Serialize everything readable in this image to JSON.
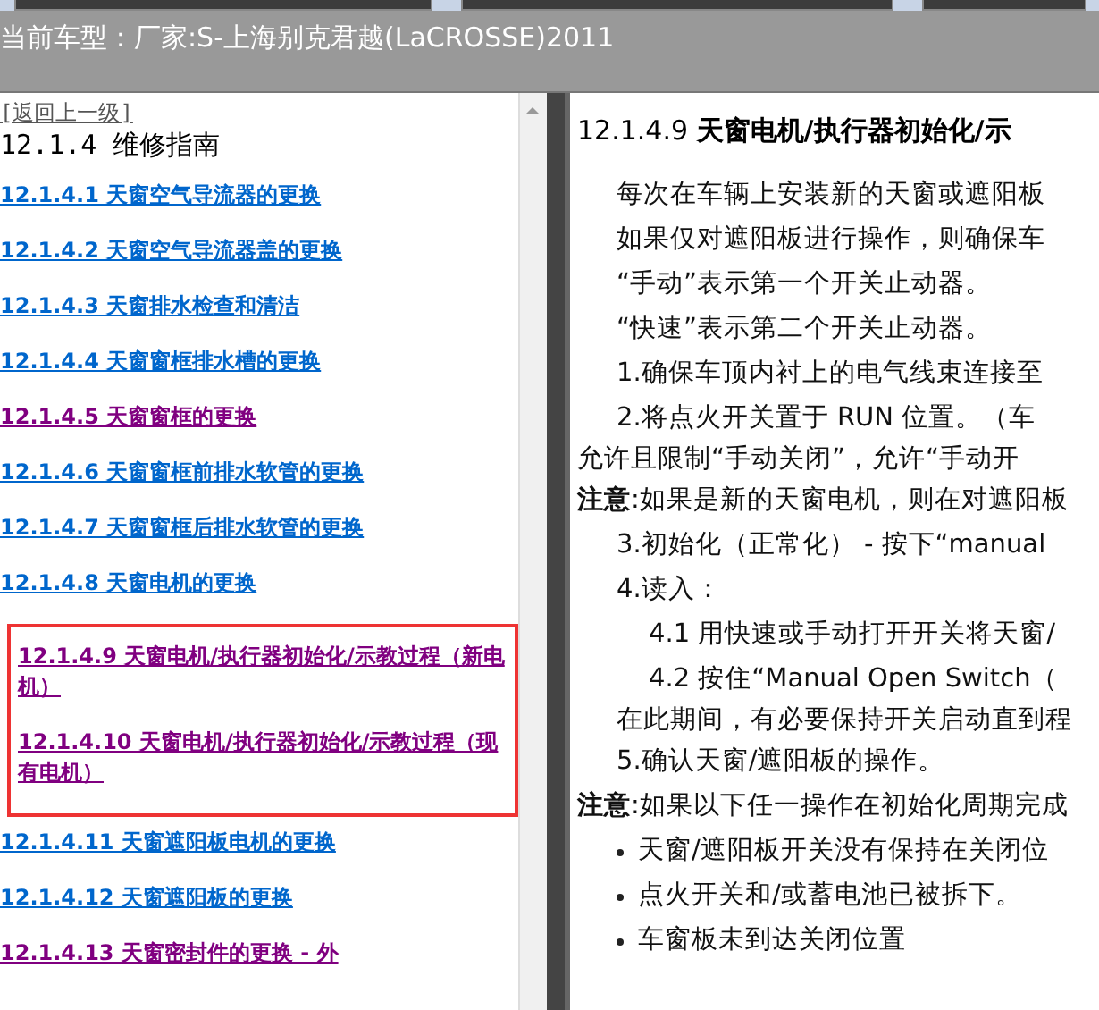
{
  "header": {
    "model_label": "当前车型：厂家:S-上海别克君越(LaCROSSE)2011"
  },
  "left_pane": {
    "back_link": "[返回上一级]",
    "heading": "12.1.4 维修指南",
    "items": [
      {
        "label": "12.1.4.1 天窗空气导流器的更换",
        "visited": false,
        "boxed": false
      },
      {
        "label": "12.1.4.2 天窗空气导流器盖的更换",
        "visited": false,
        "boxed": false
      },
      {
        "label": "12.1.4.3 天窗排水检查和清洁",
        "visited": false,
        "boxed": false
      },
      {
        "label": "12.1.4.4 天窗窗框排水槽的更换",
        "visited": false,
        "boxed": false
      },
      {
        "label": "12.1.4.5 天窗窗框的更换",
        "visited": true,
        "boxed": false
      },
      {
        "label": "12.1.4.6 天窗窗框前排水软管的更换",
        "visited": false,
        "boxed": false
      },
      {
        "label": "12.1.4.7 天窗窗框后排水软管的更换",
        "visited": false,
        "boxed": false
      },
      {
        "label": "12.1.4.8 天窗电机的更换",
        "visited": false,
        "boxed": false
      },
      {
        "label": "12.1.4.9 天窗电机/执行器初始化/示教过程（新电机）",
        "visited": true,
        "boxed": true
      },
      {
        "label": "12.1.4.10 天窗电机/执行器初始化/示教过程（现有电机）",
        "visited": true,
        "boxed": true
      },
      {
        "label": "12.1.4.11 天窗遮阳板电机的更换",
        "visited": false,
        "boxed": false
      },
      {
        "label": "12.1.4.12 天窗遮阳板的更换",
        "visited": false,
        "boxed": false
      },
      {
        "label": "12.1.4.13 天窗密封件的更换 - 外",
        "visited": true,
        "boxed": false
      }
    ]
  },
  "right_pane": {
    "title": "12.1.4.9 天窗电机/执行器初始化/示",
    "lines": [
      {
        "kind": "para",
        "text": "每次在车辆上安装新的天窗或遮阳板"
      },
      {
        "kind": "para",
        "text": "如果仅对遮阳板进行操作，则确保车"
      },
      {
        "kind": "para",
        "text": "“手动”表示第一个开关止动器。"
      },
      {
        "kind": "para",
        "text": "“快速”表示第二个开关止动器。"
      },
      {
        "kind": "para",
        "text": "1.确保车顶内衬上的电气线束连接至"
      },
      {
        "kind": "para",
        "text": "2.将点火开关置于  RUN 位置。（车"
      },
      {
        "kind": "wrap",
        "text": "允许且限制“手动关闭”，允许“手动开"
      },
      {
        "kind": "note",
        "text": "**注意**:如果是新的天窗电机，则在对遮阳板"
      },
      {
        "kind": "para",
        "text": "3.初始化（正常化） - 按下“manual"
      },
      {
        "kind": "para",
        "text": "4.读入："
      },
      {
        "kind": "subpara",
        "text": "4.1 用快速或手动打开开关将天窗/"
      },
      {
        "kind": "subpara",
        "text": "4.2 按住“Manual Open Switch（"
      },
      {
        "kind": "subwrap",
        "text": "在此期间，有必要保持开关启动直到程"
      },
      {
        "kind": "para",
        "text": "5.确认天窗/遮阳板的操作。"
      },
      {
        "kind": "note",
        "text": "**注意**:如果以下任一操作在初始化周期完成"
      },
      {
        "kind": "bullet",
        "text": "天窗/遮阳板开关没有保持在关闭位"
      },
      {
        "kind": "bullet",
        "text": "点火开关和/或蓄电池已被拆下。"
      },
      {
        "kind": "bullet",
        "text": "车窗板未到达关闭位置"
      }
    ]
  }
}
